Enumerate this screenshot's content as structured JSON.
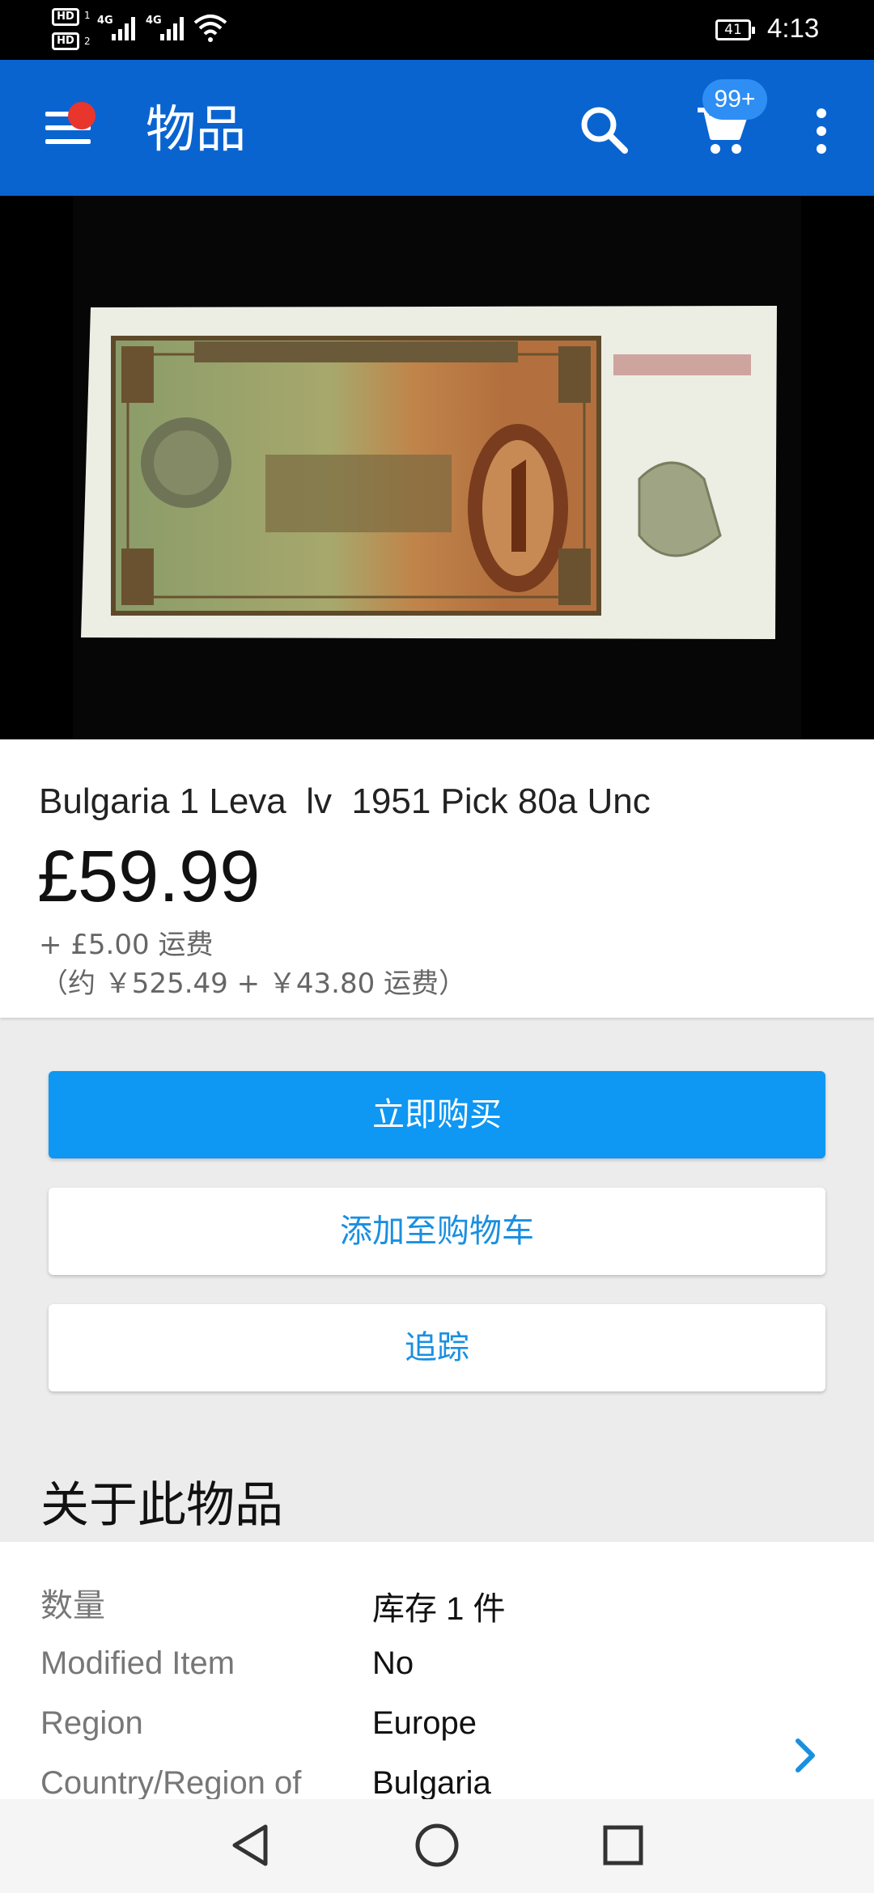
{
  "status_bar": {
    "hd1": "HD",
    "hd1_sub": "1",
    "hd2": "HD",
    "hd2_sub": "2",
    "net1": "4G",
    "net2": "4G",
    "battery": "41",
    "time": "4:13"
  },
  "app_bar": {
    "title": "物品",
    "cart_badge": "99+",
    "icons": [
      "menu-icon",
      "search-icon",
      "cart-icon",
      "more-vert-icon"
    ]
  },
  "product": {
    "title": "Bulgaria 1 Leva  lv  1951 Pick 80a Unc",
    "price": "£59.99",
    "shipping": "+ £5.00 运费",
    "converted": "（约 ￥525.49 + ￥43.80 运费）"
  },
  "actions": {
    "buy_now": "立即购买",
    "add_to_cart": "添加至购物车",
    "watch": "追踪"
  },
  "about": {
    "title": "关于此物品",
    "specs": [
      {
        "label": "数量",
        "value": "库存 1 件"
      },
      {
        "label": "Modified Item",
        "value": "No"
      },
      {
        "label": "Region",
        "value": "Europe"
      },
      {
        "label": "Country/Region of",
        "value": "Bulgaria"
      }
    ]
  },
  "nav_bar": {
    "icons": [
      "back-icon",
      "home-icon",
      "recents-icon"
    ]
  },
  "colors": {
    "app_bar": "#0a64d0",
    "primary_button": "#0e97f3",
    "link": "#1a8fe0",
    "notification_dot": "#e8362c"
  }
}
